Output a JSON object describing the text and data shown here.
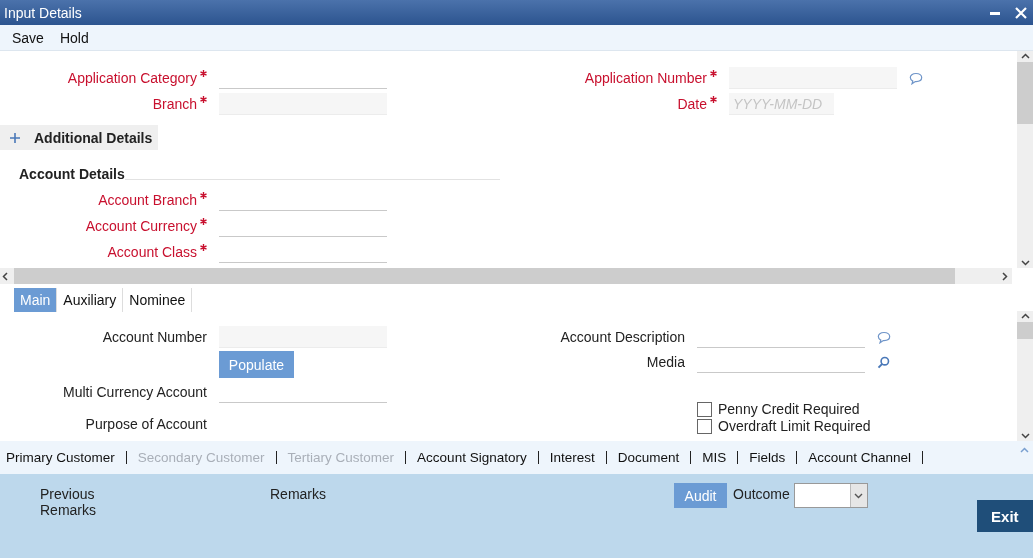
{
  "window": {
    "title": "Input Details"
  },
  "toolbar": [
    "Save",
    "Hold"
  ],
  "header_fields": {
    "left": [
      {
        "label": "Application Category",
        "required": true,
        "kind": "underline"
      },
      {
        "label": "Branch",
        "required": true,
        "kind": "shaded"
      }
    ],
    "right": [
      {
        "label": "Application Number",
        "required": true,
        "kind": "shaded"
      },
      {
        "label": "Date",
        "required": true,
        "kind": "shaded",
        "placeholder": "YYYY-MM-DD"
      }
    ]
  },
  "additional_details": {
    "label": "Additional Details",
    "expanded": false
  },
  "account_details": {
    "title": "Account Details",
    "fields": [
      {
        "label": "Account Branch",
        "required": true,
        "kind": "underline"
      },
      {
        "label": "Account Currency",
        "required": true,
        "kind": "underline"
      },
      {
        "label": "Account Class",
        "required": true,
        "kind": "underline"
      }
    ]
  },
  "tabs": [
    {
      "label": "Main",
      "selected": true
    },
    {
      "label": "Auxiliary",
      "selected": false
    },
    {
      "label": "Nominee",
      "selected": false
    }
  ],
  "main_tab": {
    "left": [
      {
        "label": "Account Number",
        "kind": "shaded"
      },
      {
        "label": "Populate",
        "kind": "button"
      },
      {
        "label": "Multi Currency Account",
        "kind": "underline"
      },
      {
        "label": "Purpose of Account",
        "kind": "none"
      }
    ],
    "right": [
      {
        "label": "Account Description",
        "kind": "underline"
      },
      {
        "label": "Media",
        "kind": "underline"
      }
    ],
    "checkboxes": [
      {
        "label": "Penny Credit Required",
        "checked": false
      },
      {
        "label": "Overdraft Limit Required",
        "checked": false
      }
    ]
  },
  "links": [
    {
      "label": "Primary Customer",
      "disabled": false
    },
    {
      "label": "Secondary Customer",
      "disabled": true
    },
    {
      "label": "Tertiary Customer",
      "disabled": true
    },
    {
      "label": "Account Signatory",
      "disabled": false
    },
    {
      "label": "Interest",
      "disabled": false
    },
    {
      "label": "Document",
      "disabled": false
    },
    {
      "label": "MIS",
      "disabled": false
    },
    {
      "label": "Fields",
      "disabled": false
    },
    {
      "label": "Account Channel",
      "disabled": false
    }
  ],
  "footer": {
    "previous_remarks_label": "Previous Remarks",
    "remarks_label": "Remarks",
    "audit_button": "Audit",
    "outcome_label": "Outcome",
    "exit_button": "Exit"
  }
}
